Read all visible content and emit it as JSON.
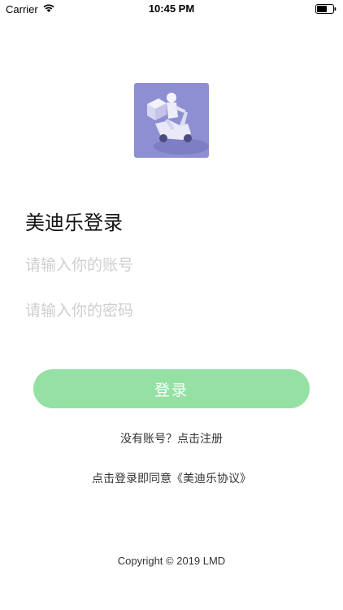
{
  "status_bar": {
    "carrier": "Carrier",
    "time": "10:45 PM"
  },
  "login": {
    "title": "美迪乐登录",
    "account_placeholder": "请输入你的账号",
    "password_placeholder": "请输入你的密码",
    "submit_label": "登录",
    "register_link": "没有账号？点击注册",
    "agreement_link": "点击登录即同意《美迪乐协议》"
  },
  "footer": {
    "copyright": "Copyright © 2019 LMD"
  },
  "colors": {
    "logo_background": "#8e8fd2",
    "button_background": "#95e0a3",
    "placeholder": "#cfcfcf"
  },
  "icons": {
    "status": [
      "wifi-icon",
      "battery-icon"
    ],
    "logo": "delivery-scooter-logo"
  }
}
